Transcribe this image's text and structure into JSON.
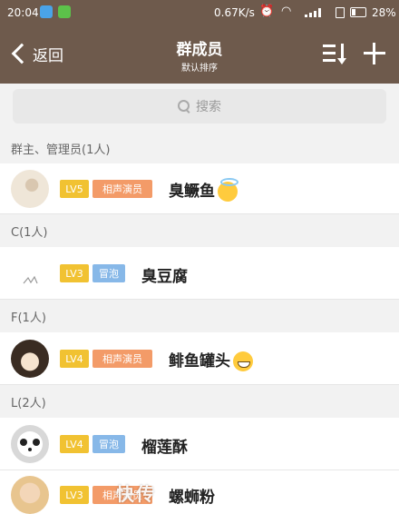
{
  "status_bar": {
    "time": "20:04",
    "network_speed": "0.67K/s",
    "battery": "28%"
  },
  "header": {
    "back_label": "返回",
    "title": "群成员",
    "subtitle": "默认排序",
    "icons": [
      "sort-icon",
      "add-icon"
    ]
  },
  "search": {
    "placeholder": "搜索"
  },
  "sections": [
    {
      "title": "群主、管理员(1人)",
      "members": [
        {
          "level": "LV5",
          "tag": "相声演员",
          "tag_color": "#f39b68",
          "name": "臭鳜鱼",
          "emoji": "halo"
        }
      ]
    },
    {
      "title": "C(1人)",
      "members": [
        {
          "level": "LV3",
          "tag": "冒泡",
          "tag_color": "#87b8e8",
          "name": "臭豆腐",
          "emoji": ""
        }
      ]
    },
    {
      "title": "F(1人)",
      "members": [
        {
          "level": "LV4",
          "tag": "相声演员",
          "tag_color": "#f39b68",
          "name": "鲱鱼罐头",
          "emoji": "grin"
        }
      ]
    },
    {
      "title": "L(2人)",
      "members": [
        {
          "level": "LV4",
          "tag": "冒泡",
          "tag_color": "#87b8e8",
          "name": "榴莲酥",
          "emoji": ""
        },
        {
          "level": "LV3",
          "tag": "相声演员",
          "tag_color": "#f39b68",
          "name": "螺蛳粉",
          "emoji": ""
        }
      ]
    }
  ],
  "colors": {
    "header_bg": "#6e5a4c",
    "level_badge": "#f1c232"
  },
  "watermark": "快传"
}
